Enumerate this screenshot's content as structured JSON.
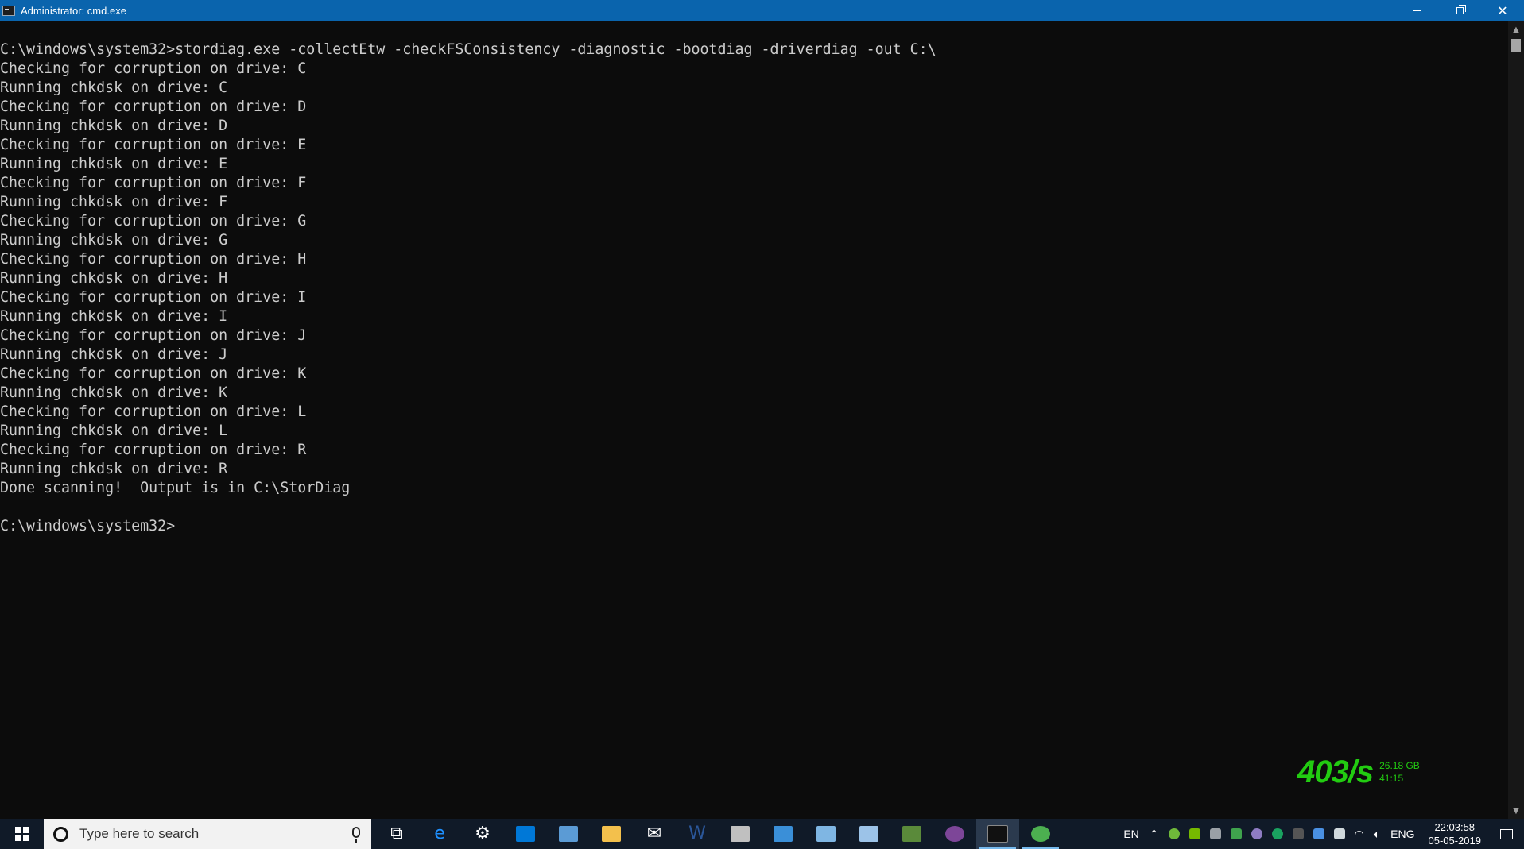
{
  "window": {
    "title": "Administrator: cmd.exe",
    "icon": "console-icon",
    "controls": {
      "minimize": "minimize-icon",
      "restore": "restore-icon",
      "close": "close-icon"
    }
  },
  "console": {
    "background": "#0c0c0c",
    "foreground": "#cccccc",
    "lines": [
      "C:\\windows\\system32>stordiag.exe -collectEtw -checkFSConsistency -diagnostic -bootdiag -driverdiag -out C:\\",
      "Checking for corruption on drive: C",
      "Running chkdsk on drive: C",
      "Checking for corruption on drive: D",
      "Running chkdsk on drive: D",
      "Checking for corruption on drive: E",
      "Running chkdsk on drive: E",
      "Checking for corruption on drive: F",
      "Running chkdsk on drive: F",
      "Checking for corruption on drive: G",
      "Running chkdsk on drive: G",
      "Checking for corruption on drive: H",
      "Running chkdsk on drive: H",
      "Checking for corruption on drive: I",
      "Running chkdsk on drive: I",
      "Checking for corruption on drive: J",
      "Running chkdsk on drive: J",
      "Checking for corruption on drive: K",
      "Running chkdsk on drive: K",
      "Checking for corruption on drive: L",
      "Running chkdsk on drive: L",
      "Checking for corruption on drive: R",
      "Running chkdsk on drive: R",
      "Done scanning!  Output is in C:\\StorDiag",
      "",
      "C:\\windows\\system32>"
    ]
  },
  "overlay": {
    "rate": "403/s",
    "size": "26.18 GB",
    "time": "41:15",
    "color": "#22cc11"
  },
  "taskbar": {
    "search_placeholder": "Type here to search",
    "apps": [
      {
        "name": "task-view-icon",
        "glyph": "⧉"
      },
      {
        "name": "edge-icon",
        "glyph": "e",
        "color": "#1e90ff"
      },
      {
        "name": "settings-icon",
        "glyph": "⚙"
      },
      {
        "name": "store-icon",
        "color": "#0078d7"
      },
      {
        "name": "control-panel-icon",
        "color": "#5b9bd5"
      },
      {
        "name": "file-explorer-icon",
        "color": "#f3c04c"
      },
      {
        "name": "mail-icon",
        "glyph": "✉"
      },
      {
        "name": "word-icon",
        "glyph": "W",
        "color": "#2b579a"
      },
      {
        "name": "paint-icon",
        "color": "#c0c0c0"
      },
      {
        "name": "network-app-icon",
        "color": "#3a8fd8"
      },
      {
        "name": "notepad-icon",
        "color": "#7fb6e3"
      },
      {
        "name": "wordpad-icon",
        "color": "#9cc3e8"
      },
      {
        "name": "tree-app-icon",
        "color": "#5a8a3a"
      },
      {
        "name": "tor-browser-icon",
        "color": "#7d4698"
      },
      {
        "name": "cmd-icon",
        "color": "#111111"
      },
      {
        "name": "chrome-icon",
        "color": "#4caf50"
      }
    ],
    "language_short": "EN",
    "language_long": "ENG",
    "clock": {
      "time": "22:03:58",
      "date": "05-05-2019"
    }
  }
}
